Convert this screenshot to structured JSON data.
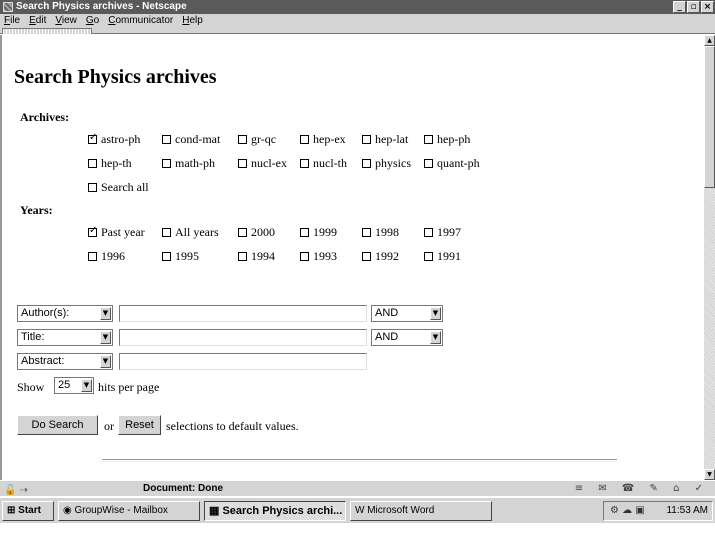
{
  "window": {
    "title": "Search Physics archives - Netscape",
    "buttons": [
      "_",
      "▫",
      "×"
    ]
  },
  "menu": [
    "File",
    "Edit",
    "View",
    "Go",
    "Communicator",
    "Help"
  ],
  "page": {
    "title": "Search Physics archives",
    "archives_label": "Archives:",
    "archives": [
      {
        "label": "astro-ph",
        "checked": true
      },
      {
        "label": "cond-mat",
        "checked": false
      },
      {
        "label": "gr-qc",
        "checked": false
      },
      {
        "label": "hep-ex",
        "checked": false
      },
      {
        "label": "hep-lat",
        "checked": false
      },
      {
        "label": "hep-ph",
        "checked": false
      },
      {
        "label": "hep-th",
        "checked": false
      },
      {
        "label": "math-ph",
        "checked": false
      },
      {
        "label": "nucl-ex",
        "checked": false
      },
      {
        "label": "nucl-th",
        "checked": false
      },
      {
        "label": "physics",
        "checked": false
      },
      {
        "label": "quant-ph",
        "checked": false
      },
      {
        "label": "Search all",
        "checked": false
      }
    ],
    "years_label": "Years:",
    "years": [
      {
        "label": "Past year",
        "checked": true
      },
      {
        "label": "All years",
        "checked": false
      },
      {
        "label": "2000",
        "checked": false
      },
      {
        "label": "1999",
        "checked": false
      },
      {
        "label": "1998",
        "checked": false
      },
      {
        "label": "1997",
        "checked": false
      },
      {
        "label": "1996",
        "checked": false
      },
      {
        "label": "1995",
        "checked": false
      },
      {
        "label": "1994",
        "checked": false
      },
      {
        "label": "1993",
        "checked": false
      },
      {
        "label": "1992",
        "checked": false
      },
      {
        "label": "1991",
        "checked": false
      }
    ],
    "fields": [
      {
        "selected": "Author(s):",
        "value": "",
        "op": "AND"
      },
      {
        "selected": "Title:",
        "value": "",
        "op": "AND"
      },
      {
        "selected": "Abstract:",
        "value": ""
      }
    ],
    "show_label": "Show",
    "hits_value": "25",
    "hits_suffix": "hits per page",
    "search_button": "Do Search",
    "or_text": "or",
    "reset_button": "Reset",
    "reset_suffix": "selections to default values."
  },
  "status": {
    "text": "Document: Done"
  },
  "taskbar": {
    "start": "Start",
    "items": [
      {
        "label": "GroupWise - Mailbox",
        "active": false
      },
      {
        "label": "Search Physics archi...",
        "active": true
      },
      {
        "label": "Microsoft Word",
        "active": false
      }
    ],
    "clock": "11:53 AM"
  }
}
